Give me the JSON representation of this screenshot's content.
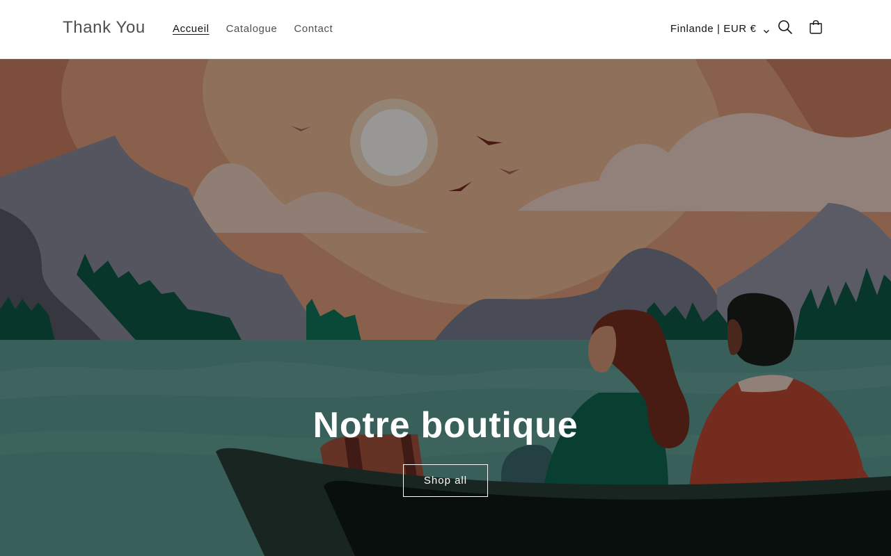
{
  "header": {
    "logo": "Thank You",
    "nav": [
      {
        "label": "Accueil",
        "active": true
      },
      {
        "label": "Catalogue",
        "active": false
      },
      {
        "label": "Contact",
        "active": false
      }
    ],
    "localization": "Finlande | EUR €",
    "icons": {
      "search": "search-icon",
      "cart": "cart-icon",
      "chevron": "chevron-down-icon"
    }
  },
  "hero": {
    "title": "Notre boutique",
    "button_label": "Shop all",
    "overlay_opacity": 0.4
  }
}
